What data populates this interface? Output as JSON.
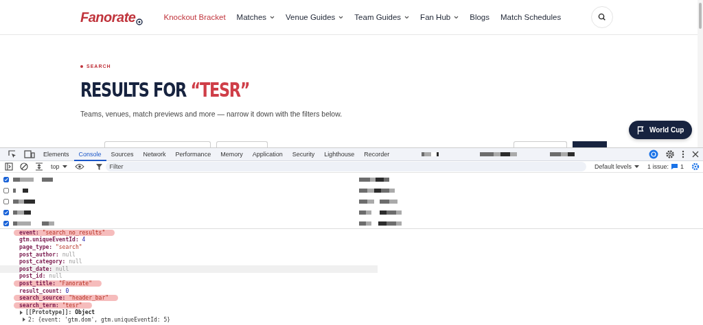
{
  "site_header": {
    "logo": "Fanorate",
    "nav": [
      {
        "label": "Knockout Bracket",
        "selected": true,
        "dropdown": false
      },
      {
        "label": "Matches",
        "selected": false,
        "dropdown": true
      },
      {
        "label": "Venue Guides",
        "selected": false,
        "dropdown": true
      },
      {
        "label": "Team Guides",
        "selected": false,
        "dropdown": true
      },
      {
        "label": "Fan Hub",
        "selected": false,
        "dropdown": true
      },
      {
        "label": "Blogs",
        "selected": false,
        "dropdown": false
      },
      {
        "label": "Match Schedules",
        "selected": false,
        "dropdown": false
      }
    ]
  },
  "hero": {
    "eyebrow": "SEARCH",
    "title": "RESULTS FOR",
    "query": "“TESR”",
    "subtitle": "Teams, venues, match previews and more — narrow it down with the filters below."
  },
  "floating_button": {
    "label": "World Cup"
  },
  "devtools": {
    "tabs": [
      {
        "label": "Elements",
        "selected": false
      },
      {
        "label": "Console",
        "selected": true
      },
      {
        "label": "Sources",
        "selected": false
      },
      {
        "label": "Network",
        "selected": false
      },
      {
        "label": "Performance",
        "selected": false
      },
      {
        "label": "Memory",
        "selected": false
      },
      {
        "label": "Application",
        "selected": false
      },
      {
        "label": "Security",
        "selected": false
      },
      {
        "label": "Lighthouse",
        "selected": false
      },
      {
        "label": "Recorder",
        "selected": false
      }
    ],
    "context": "top",
    "filter_placeholder": "Filter",
    "levels": "Default levels",
    "issues": "1 issue:",
    "issue_count": "1",
    "log_rows": [
      {
        "checked": true
      },
      {
        "checked": false
      },
      {
        "checked": false
      },
      {
        "checked": true
      },
      {
        "checked": true
      }
    ],
    "object_lines": [
      {
        "key": "event:",
        "value": "\"search_no_results\"",
        "kind": "string",
        "highlighted": true,
        "hovered": false
      },
      {
        "key": "gtm.uniqueEventId:",
        "value": "4",
        "kind": "number",
        "highlighted": false,
        "hovered": false
      },
      {
        "key": "page_type:",
        "value": "\"search\"",
        "kind": "string",
        "highlighted": false,
        "hovered": false
      },
      {
        "key": "post_author:",
        "value": "null",
        "kind": "null",
        "highlighted": false,
        "hovered": false
      },
      {
        "key": "post_category:",
        "value": "null",
        "kind": "null",
        "highlighted": false,
        "hovered": false
      },
      {
        "key": "post_date:",
        "value": "null",
        "kind": "null",
        "highlighted": false,
        "hovered": true
      },
      {
        "key": "post_id:",
        "value": "null",
        "kind": "null",
        "highlighted": false,
        "hovered": false
      },
      {
        "key": "post_title:",
        "value": "\"Fanorate\"",
        "kind": "string",
        "highlighted": true,
        "hovered": false
      },
      {
        "key": "result_count:",
        "value": "0",
        "kind": "number",
        "highlighted": false,
        "hovered": false
      },
      {
        "key": "search_source:",
        "value": "\"header_bar\"",
        "kind": "string",
        "highlighted": true,
        "hovered": false
      },
      {
        "key": "search_term:",
        "value": "\"tesr\"",
        "kind": "string",
        "highlighted": true,
        "hovered": false
      },
      {
        "key": "[[Prototype]]:",
        "value": "Object",
        "kind": "proto",
        "highlighted": false,
        "hovered": false
      }
    ],
    "next_entry": "2: {event: 'gtm.dom', gtm.uniqueEventId: 5}"
  }
}
